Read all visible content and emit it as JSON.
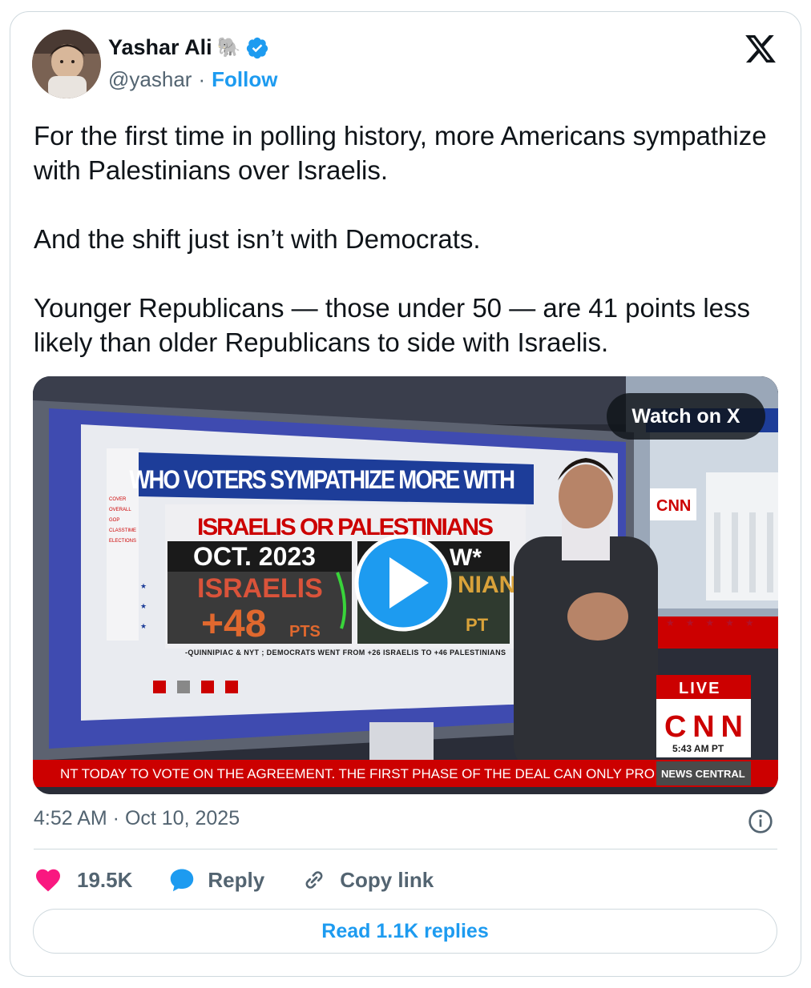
{
  "author": {
    "name": "Yashar Ali",
    "emoji": "🐘",
    "handle": "@yashar",
    "separator": "·",
    "follow_label": "Follow"
  },
  "tweet": {
    "paragraphs": [
      "For the first time in polling history, more Americans sympathize with Palestinians over Israelis.",
      "And the shift just isn’t with Democrats.",
      "Younger Republicans — those under 50 — are 41 points less likely than older Republicans to side with Israelis."
    ]
  },
  "media": {
    "watch_label": "Watch on X",
    "screen_title": "WHO VOTERS SYMPATHIZE MORE WITH",
    "screen_subtitle": "ISRAELIS OR PALESTINIANS",
    "left_col_head": "OCT. 2023",
    "left_col_label": "ISRAELIS",
    "left_col_value": "+48",
    "left_col_unit": "PTS",
    "right_col_head": "W*",
    "right_col_label": "NIANS",
    "right_col_unit": "PT",
    "screen_source": "-QUINNIPIAC & NYT ; DEMOCRATS WENT FROM +26 ISRAELIS TO +46 PALESTINIANS",
    "side_labels": [
      "COVER",
      "OVERALL",
      "GOP",
      "CLASSTIME",
      "ELECTIONS"
    ],
    "network_logo": "CNN",
    "live_label": "LIVE",
    "live_logo": "CNN",
    "live_time": "5:43 AM PT",
    "ticker_text": "NT TODAY TO VOTE ON THE AGREEMENT. THE FIRST PHASE OF THE DEAL CAN ONLY PRO",
    "ticker_badge": "NEWS CENTRAL",
    "colors": {
      "cnn_red": "#cc0000",
      "screen_blue": "#1d3d99",
      "play_blue": "#1d9bf0"
    }
  },
  "meta": {
    "timestamp": "4:52 AM · Oct 10, 2025"
  },
  "actions": {
    "like_count": "19.5K",
    "reply_label": "Reply",
    "copy_label": "Copy link"
  },
  "read_replies_label": "Read 1.1K replies",
  "colors": {
    "like": "#f91880",
    "link": "#1d9bf0",
    "muted": "#536471",
    "border": "#cfd9de"
  }
}
